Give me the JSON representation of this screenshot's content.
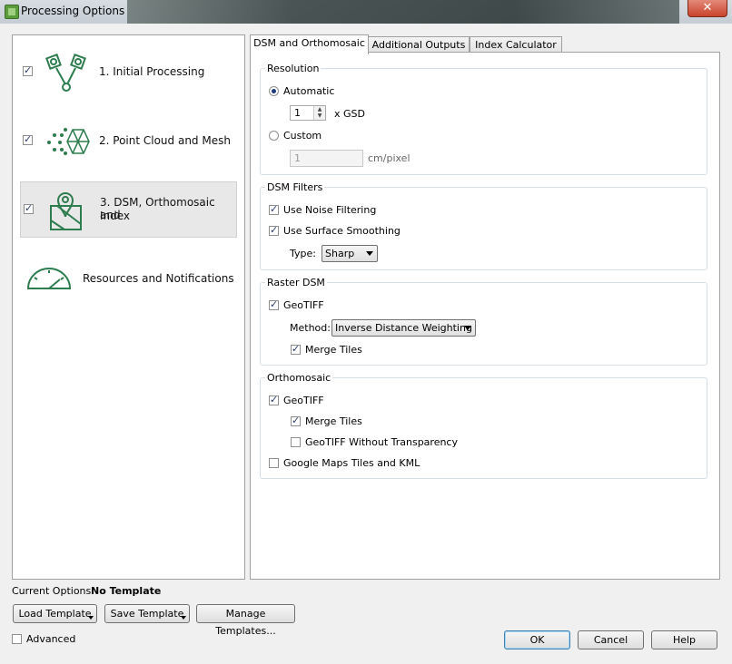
{
  "window": {
    "title": "Processing Options",
    "close_label": "✕"
  },
  "steps": [
    {
      "label": "1. Initial Processing",
      "checked": true,
      "icon": "initial-processing-icon"
    },
    {
      "label": "2. Point Cloud and Mesh",
      "checked": true,
      "icon": "point-cloud-icon"
    },
    {
      "label": "3. DSM, Orthomosaic and",
      "label2": "Index",
      "checked": true,
      "icon": "map-icon",
      "active": true
    },
    {
      "label": "Resources and Notifications",
      "icon": "gauge-icon"
    }
  ],
  "tabs": [
    {
      "label": "DSM and Orthomosaic",
      "active": true
    },
    {
      "label": "Additional Outputs"
    },
    {
      "label": "Index Calculator"
    }
  ],
  "resolution": {
    "title": "Resolution",
    "automatic_label": "Automatic",
    "automatic_selected": true,
    "gsd_value": "1",
    "gsd_unit": "x GSD",
    "custom_label": "Custom",
    "custom_value": "1",
    "custom_unit": "cm/pixel"
  },
  "dsm_filters": {
    "title": "DSM Filters",
    "noise_label": "Use Noise Filtering",
    "smoothing_label": "Use Surface Smoothing",
    "type_label": "Type:",
    "type_value": "Sharp"
  },
  "raster_dsm": {
    "title": "Raster DSM",
    "geotiff_label": "GeoTIFF",
    "method_label": "Method:",
    "method_value": "Inverse Distance Weighting",
    "merge_label": "Merge Tiles"
  },
  "orthomosaic": {
    "title": "Orthomosaic",
    "geotiff_label": "GeoTIFF",
    "merge_label": "Merge Tiles",
    "no_transparency_label": "GeoTIFF Without Transparency",
    "google_label": "Google Maps Tiles and KML"
  },
  "footer": {
    "current_options_label": "Current Options:",
    "current_options_value": "No Template",
    "load_template": "Load Template",
    "save_template": "Save Template",
    "manage_templates": "Manage Templates...",
    "advanced_label": "Advanced",
    "ok": "OK",
    "cancel": "Cancel",
    "help": "Help"
  },
  "colors": {
    "icon_green": "#2e7d4f",
    "accent": "#3c7fb1"
  }
}
